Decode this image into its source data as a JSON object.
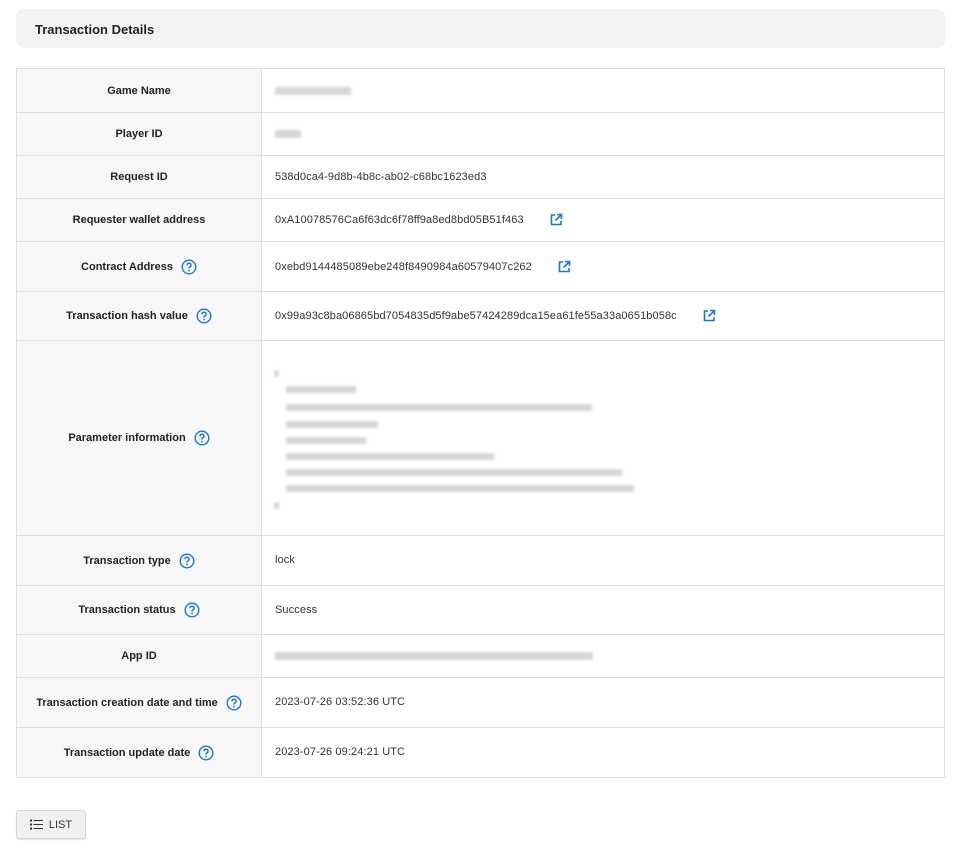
{
  "header": {
    "title": "Transaction Details"
  },
  "rows": {
    "game_name": {
      "label": "Game Name",
      "value": ""
    },
    "player_id": {
      "label": "Player ID",
      "value": ""
    },
    "request_id": {
      "label": "Request ID",
      "value": "538d0ca4-9d8b-4b8c-ab02-c68bc1623ed3"
    },
    "requester_wallet": {
      "label": "Requester wallet address",
      "value": "0xA10078576Ca6f63dc6f78ff9a8ed8bd05B51f463"
    },
    "contract_address": {
      "label": "Contract Address",
      "value": "0xebd9144485089ebe248f8490984a60579407c262"
    },
    "tx_hash": {
      "label": "Transaction hash value",
      "value": "0x99a93c8ba06865bd7054835d5f9abe57424289dca15ea61fe55a33a0651b058c"
    },
    "parameter_info": {
      "label": "Parameter information",
      "value": ""
    },
    "tx_type": {
      "label": "Transaction type",
      "value": "lock"
    },
    "tx_status": {
      "label": "Transaction status",
      "value": "Success"
    },
    "app_id": {
      "label": "App ID",
      "value": ""
    },
    "tx_created": {
      "label": "Transaction creation date and time",
      "value": "2023-07-26 03:52:36 UTC"
    },
    "tx_updated": {
      "label": "Transaction update date",
      "value": "2023-07-26 09:24:21 UTC"
    }
  },
  "list_button": {
    "label": "LIST",
    "icon": "list-icon"
  },
  "icons": {
    "help": "help-circle-icon",
    "external": "external-link-icon"
  },
  "colors": {
    "accent": "#1976d2",
    "label_bg": "#f7f7f7",
    "header_bg": "#f3f3f3",
    "border": "#dedede"
  }
}
